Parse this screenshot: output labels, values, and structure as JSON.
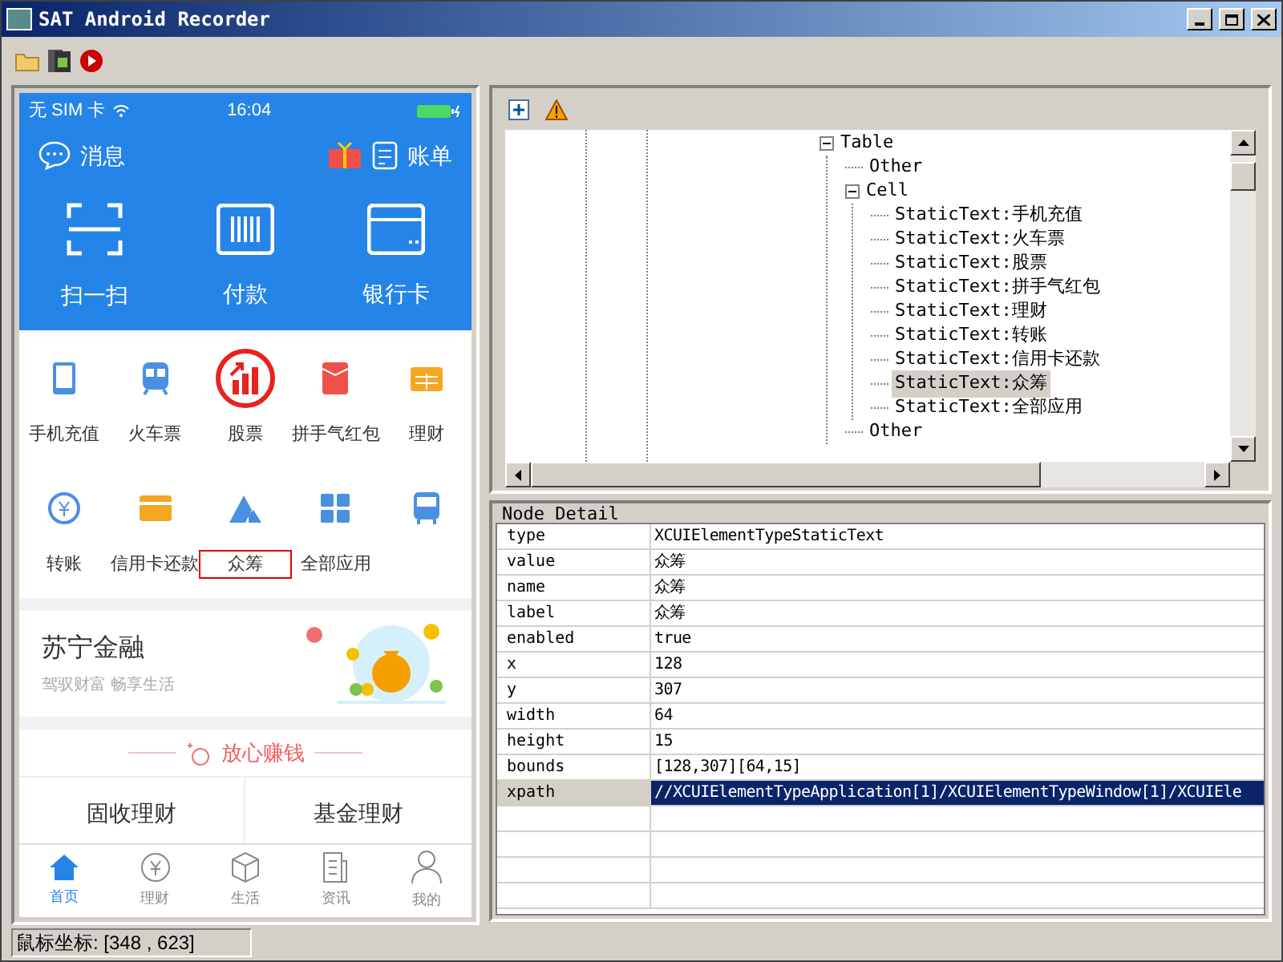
{
  "window": {
    "title": "SAT Android Recorder"
  },
  "phone": {
    "status": {
      "carrier": "无 SIM 卡",
      "time": "16:04"
    },
    "header": {
      "messages": "消息",
      "bill": "账单"
    },
    "actions": [
      "扫一扫",
      "付款",
      "银行卡"
    ],
    "apps": [
      {
        "label": "手机充值",
        "highlighted": false
      },
      {
        "label": "火车票",
        "highlighted": false
      },
      {
        "label": "股票",
        "highlighted": false
      },
      {
        "label": "拼手气红包",
        "highlighted": false
      },
      {
        "label": "理财",
        "highlighted": false
      },
      {
        "label": "转账",
        "highlighted": false
      },
      {
        "label": "信用卡还款",
        "highlighted": false
      },
      {
        "label": "众筹",
        "highlighted": true
      },
      {
        "label": "全部应用",
        "highlighted": false
      }
    ],
    "banner": {
      "title": "苏宁金融",
      "subtitle": "驾驭财富 畅享生活"
    },
    "section_title": "放心赚钱",
    "products": [
      "固收理财",
      "基金理财"
    ],
    "tabs": [
      {
        "label": "首页",
        "selected": true
      },
      {
        "label": "理财",
        "selected": false
      },
      {
        "label": "生活",
        "selected": false
      },
      {
        "label": "资讯",
        "selected": false
      },
      {
        "label": "我的",
        "selected": false
      }
    ]
  },
  "tree": [
    {
      "label": "Table",
      "expanded": true,
      "selected": false,
      "children": [
        {
          "label": "Other",
          "selected": false
        },
        {
          "label": "Cell",
          "expanded": true,
          "selected": false,
          "children": [
            {
              "label": "StaticText:手机充值",
              "selected": false
            },
            {
              "label": "StaticText:火车票",
              "selected": false
            },
            {
              "label": "StaticText:股票",
              "selected": false
            },
            {
              "label": "StaticText:拼手气红包",
              "selected": false
            },
            {
              "label": "StaticText:理财",
              "selected": false
            },
            {
              "label": "StaticText:转账",
              "selected": false
            },
            {
              "label": "StaticText:信用卡还款",
              "selected": false
            },
            {
              "label": "StaticText:众筹",
              "selected": true
            },
            {
              "label": "StaticText:全部应用",
              "selected": false
            }
          ]
        },
        {
          "label": "Other",
          "selected": false
        }
      ]
    }
  ],
  "node_detail": {
    "title": "Node Detail",
    "rows": [
      {
        "key": "type",
        "value": "XCUIElementTypeStaticText",
        "selected": false
      },
      {
        "key": "value",
        "value": "众筹",
        "selected": false
      },
      {
        "key": "name",
        "value": "众筹",
        "selected": false
      },
      {
        "key": "label",
        "value": "众筹",
        "selected": false
      },
      {
        "key": "enabled",
        "value": "true",
        "selected": false
      },
      {
        "key": "x",
        "value": "128",
        "selected": false
      },
      {
        "key": "y",
        "value": "307",
        "selected": false
      },
      {
        "key": "width",
        "value": "64",
        "selected": false
      },
      {
        "key": "height",
        "value": "15",
        "selected": false
      },
      {
        "key": "bounds",
        "value": "[128,307][64,15]",
        "selected": false
      },
      {
        "key": "xpath",
        "value": "//XCUIElementTypeApplication[1]/XCUIElementTypeWindow[1]/XCUIEle",
        "selected": true
      }
    ]
  },
  "status_bar": {
    "text": "鼠标坐标: [348 , 623]"
  }
}
